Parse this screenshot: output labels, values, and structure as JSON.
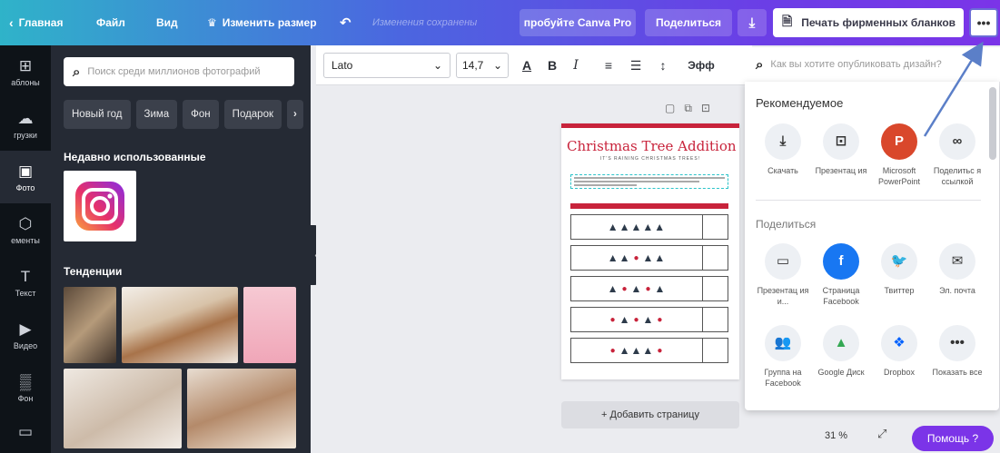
{
  "topbar": {
    "home": "Главная",
    "file": "Файл",
    "view": "Вид",
    "resize": "Изменить размер",
    "status": "Изменения сохранены",
    "try_pro": "пробуйте Canva Pro",
    "share": "Поделиться",
    "print": "Печать фирменных бланков",
    "more": "•••"
  },
  "rail": [
    {
      "label": "аблоны",
      "icon": "layout-icon"
    },
    {
      "label": "грузки",
      "icon": "upload-icon"
    },
    {
      "label": "Фото",
      "icon": "photo-icon"
    },
    {
      "label": "ементы",
      "icon": "elements-icon"
    },
    {
      "label": "Текст",
      "icon": "text-icon"
    },
    {
      "label": "Видео",
      "icon": "video-icon"
    },
    {
      "label": "Фон",
      "icon": "background-icon"
    }
  ],
  "panel": {
    "search_placeholder": "Поиск среди миллионов фотографий",
    "chips": [
      "Новый год",
      "Зима",
      "Фон",
      "Подарок"
    ],
    "recent_title": "Недавно использованные",
    "trends_title": "Тенденции"
  },
  "toolbar": {
    "font": "Lato",
    "size": "14,7",
    "effects": "Эфф"
  },
  "document": {
    "title": "Christmas Tree Addition",
    "subtitle": "IT'S RAINING CHRISTMAS TREES!",
    "add_page": "+ Добавить страницу"
  },
  "dropdown": {
    "search_placeholder": "Как вы хотите опубликовать дизайн?",
    "recommended_title": "Рекомендуемое",
    "share_title": "Поделиться",
    "recommended": [
      {
        "label": "Скачать",
        "icon": "download-icon"
      },
      {
        "label": "Презентац ия",
        "icon": "presentation-icon"
      },
      {
        "label": "Microsoft PowerPoint",
        "icon": "powerpoint-icon"
      },
      {
        "label": "Поделитьс я ссылкой",
        "icon": "link-icon"
      }
    ],
    "share": [
      {
        "label": "Презентац ия и...",
        "icon": "record-icon"
      },
      {
        "label": "Страница Facebook",
        "icon": "facebook-icon"
      },
      {
        "label": "Твиттер",
        "icon": "twitter-icon"
      },
      {
        "label": "Эл. почта",
        "icon": "mail-icon"
      },
      {
        "label": "Группа на Facebook",
        "icon": "group-icon"
      },
      {
        "label": "Google Диск",
        "icon": "drive-icon"
      },
      {
        "label": "Dropbox",
        "icon": "dropbox-icon"
      },
      {
        "label": "Показать все",
        "icon": "more-icon"
      }
    ]
  },
  "footer": {
    "zoom": "31 %",
    "help": "Помощь ?"
  },
  "colors": {
    "accent": "#7b34e8",
    "doc_red": "#c8233b",
    "panel": "#252a34"
  }
}
